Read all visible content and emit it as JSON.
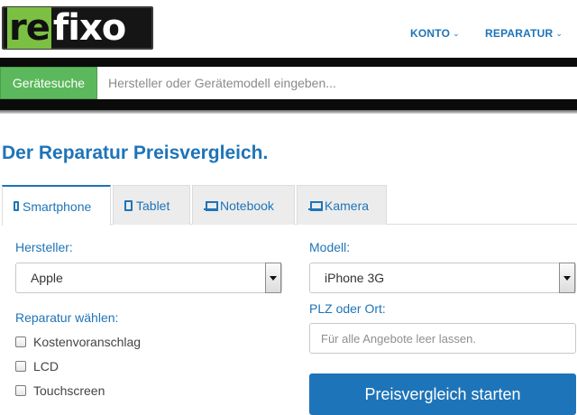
{
  "header": {
    "logo_text": "refixo",
    "nav": [
      {
        "label": "KONTO"
      },
      {
        "label": "REPARATUR"
      }
    ]
  },
  "search": {
    "button_label": "Gerätesuche",
    "placeholder": "Hersteller oder Gerätemodell eingeben..."
  },
  "main": {
    "heading_prefix": "Der Reparatur ",
    "heading_bold": "Preisvergleich",
    "heading_suffix": ".",
    "tabs": [
      {
        "label": "Smartphone",
        "icon": "smartphone-icon",
        "active": true
      },
      {
        "label": "Tablet",
        "icon": "tablet-icon",
        "active": false
      },
      {
        "label": "Notebook",
        "icon": "laptop-icon",
        "active": false
      },
      {
        "label": "Kamera",
        "icon": "laptop-icon",
        "active": false
      }
    ],
    "form": {
      "manufacturer_label": "Hersteller:",
      "manufacturer_value": "Apple",
      "model_label": "Modell:",
      "model_value": "iPhone 3G",
      "repair_label": "Reparatur wählen:",
      "repair_options": [
        {
          "label": "Kostenvoranschlag",
          "checked": false
        },
        {
          "label": "LCD",
          "checked": false
        },
        {
          "label": "Touchscreen",
          "checked": false
        }
      ],
      "location_label": "PLZ oder Ort:",
      "location_placeholder": "Für alle Angebote leer lassen.",
      "submit_label": "Preisvergleich starten"
    }
  },
  "colors": {
    "accent": "#1e74b8",
    "search_button": "#5cb85c",
    "header_dark": "#0b0b0b"
  }
}
